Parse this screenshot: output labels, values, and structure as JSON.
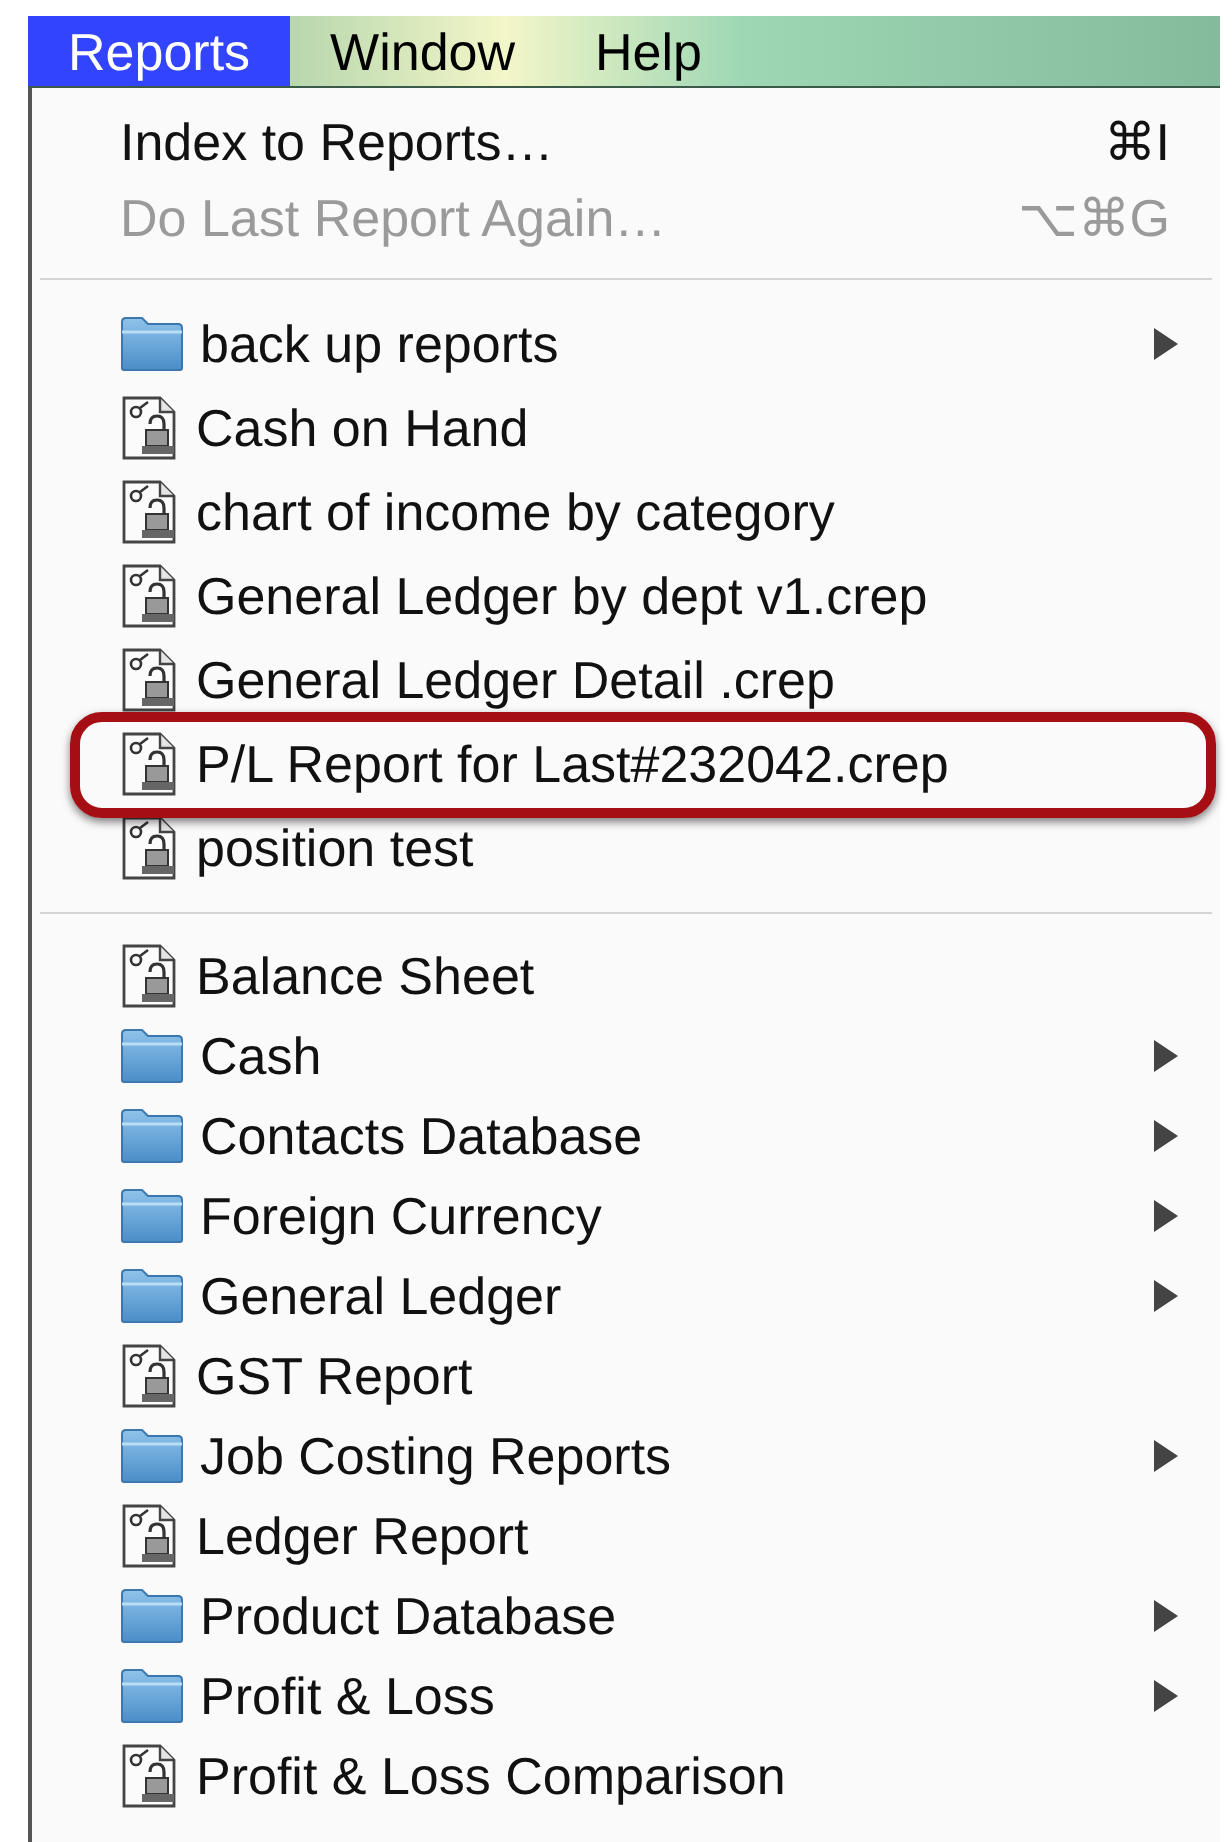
{
  "menu_bar": [
    {
      "label": "Reports",
      "selected": true
    },
    {
      "label": "Window",
      "selected": false
    },
    {
      "label": "Help",
      "selected": false
    }
  ],
  "menu": {
    "commands": [
      {
        "label": "Index to Reports…",
        "shortcut": "⌘I",
        "disabled": false
      },
      {
        "label": "Do Last Report Again…",
        "shortcut": "⌥⌘G",
        "disabled": true
      }
    ],
    "groups": [
      {
        "items": [
          {
            "kind": "folder",
            "label": "back up reports",
            "submenu": true,
            "highlighted": false
          },
          {
            "kind": "report",
            "label": "Cash on Hand",
            "submenu": false,
            "highlighted": false
          },
          {
            "kind": "report",
            "label": "chart of income by category",
            "submenu": false,
            "highlighted": false
          },
          {
            "kind": "report",
            "label": "General Ledger by dept v1.crep",
            "submenu": false,
            "highlighted": false
          },
          {
            "kind": "report",
            "label": "General Ledger Detail .crep",
            "submenu": false,
            "highlighted": false
          },
          {
            "kind": "report",
            "label": "P/L Report for Last#232042.crep",
            "submenu": false,
            "highlighted": true
          },
          {
            "kind": "report",
            "label": "position test",
            "submenu": false,
            "highlighted": false
          }
        ]
      },
      {
        "items": [
          {
            "kind": "report",
            "label": "Balance Sheet",
            "submenu": false,
            "highlighted": false
          },
          {
            "kind": "folder",
            "label": "Cash",
            "submenu": true,
            "highlighted": false
          },
          {
            "kind": "folder",
            "label": "Contacts Database",
            "submenu": true,
            "highlighted": false
          },
          {
            "kind": "folder",
            "label": "Foreign Currency",
            "submenu": true,
            "highlighted": false
          },
          {
            "kind": "folder",
            "label": "General Ledger",
            "submenu": true,
            "highlighted": false
          },
          {
            "kind": "report",
            "label": "GST Report",
            "submenu": false,
            "highlighted": false
          },
          {
            "kind": "folder",
            "label": "Job Costing Reports",
            "submenu": true,
            "highlighted": false
          },
          {
            "kind": "report",
            "label": "Ledger Report",
            "submenu": false,
            "highlighted": false
          },
          {
            "kind": "folder",
            "label": "Product Database",
            "submenu": true,
            "highlighted": false
          },
          {
            "kind": "folder",
            "label": "Profit & Loss",
            "submenu": true,
            "highlighted": false
          },
          {
            "kind": "report",
            "label": "Profit & Loss Comparison",
            "submenu": false,
            "highlighted": false
          }
        ]
      }
    ]
  }
}
